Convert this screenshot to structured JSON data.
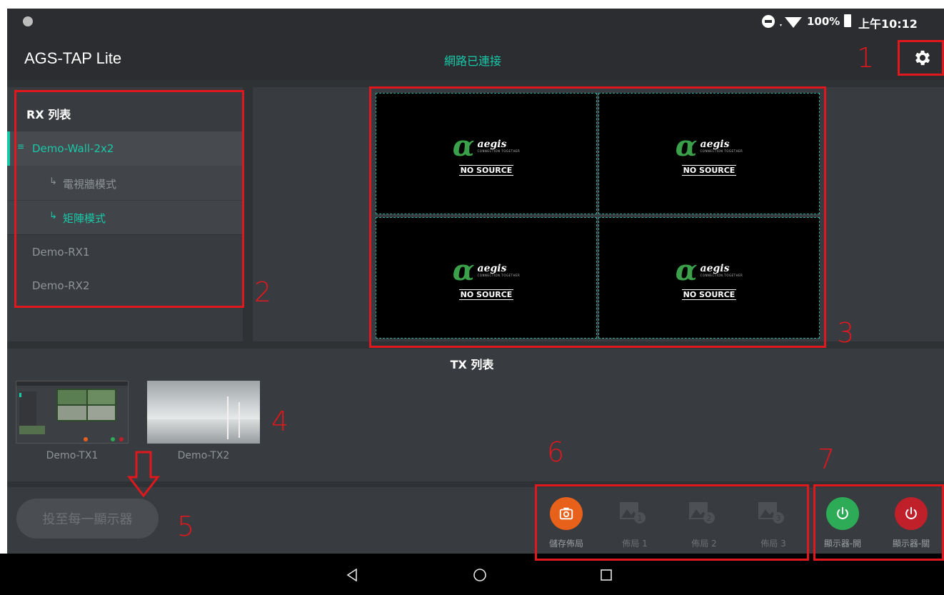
{
  "status_bar": {
    "battery": "100%",
    "time": "上午10:12"
  },
  "app_bar": {
    "title": "AGS-TAP Lite",
    "network_status": "網路已連接",
    "settings_icon": "gear-icon"
  },
  "rx_list": {
    "header": "RX 列表",
    "items": [
      {
        "label": "Demo-Wall-2x2",
        "selected": true
      },
      {
        "label": "電視牆模式",
        "sub": true,
        "active": false
      },
      {
        "label": "矩陣模式",
        "sub": true,
        "active": true
      },
      {
        "label": "Demo-RX1"
      },
      {
        "label": "Demo-RX2"
      }
    ]
  },
  "video_wall": {
    "tiles": [
      {
        "brand": "aegis",
        "tagline": "CONNECTION TOGETHER",
        "status": "NO SOURCE"
      },
      {
        "brand": "aegis",
        "tagline": "CONNECTION TOGETHER",
        "status": "NO SOURCE"
      },
      {
        "brand": "aegis",
        "tagline": "CONNECTION TOGETHER",
        "status": "NO SOURCE"
      },
      {
        "brand": "aegis",
        "tagline": "CONNECTION TOGETHER",
        "status": "NO SOURCE"
      }
    ]
  },
  "tx_list": {
    "header": "TX 列表",
    "items": [
      {
        "label": "Demo-TX1"
      },
      {
        "label": "Demo-TX2"
      }
    ]
  },
  "cast_button": {
    "label": "投至每一顯示器"
  },
  "toolbar": {
    "save_layout": "儲存佈局",
    "layout_1": "佈局 1",
    "layout_2": "佈局 2",
    "layout_3": "佈局 3",
    "display_on": "顯示器-開",
    "display_off": "顯示器-關"
  },
  "annotations": [
    "1",
    "2",
    "3",
    "4",
    "5",
    "6",
    "7"
  ],
  "colors": {
    "accent": "#19c8a8",
    "highlight": "#e0181d",
    "save": "#e8611a",
    "on": "#2eab57",
    "off": "#c0202a"
  }
}
